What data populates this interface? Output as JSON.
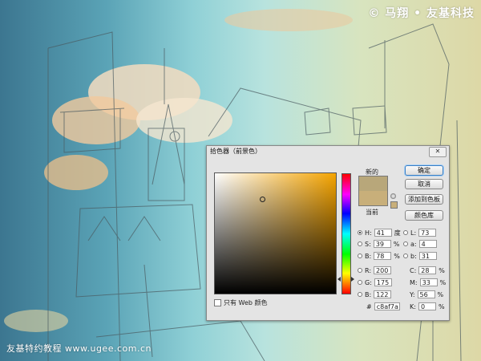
{
  "watermark_top": "© 马翔 • 友基科技",
  "watermark_bottom": "友基特约教程  www.ugee.com.cn",
  "dialog": {
    "title": "拾色器（前景色）",
    "close_label": "✕",
    "new_label": "新的",
    "current_label": "当前",
    "new_color": "#b8a77a",
    "current_color": "#c8af7a",
    "buttons": {
      "ok": "确定",
      "cancel": "取消",
      "add_swatch": "添加到色板",
      "color_libraries": "颜色库"
    },
    "web_only_label": "只有 Web 颜色",
    "hsb": {
      "h_label": "H:",
      "h_value": "41",
      "h_unit": "度",
      "s_label": "S:",
      "s_value": "39",
      "s_unit": "%",
      "b_label": "B:",
      "b_value": "78",
      "b_unit": "%"
    },
    "rgb": {
      "r_label": "R:",
      "r_value": "200",
      "g_label": "G:",
      "g_value": "175",
      "b_label": "B:",
      "b_value": "122"
    },
    "lab": {
      "l_label": "L:",
      "l_value": "73",
      "a_label": "a:",
      "a_value": "4",
      "b_label": "b:",
      "b_value": "31"
    },
    "cmyk": {
      "c_label": "C:",
      "c_value": "28",
      "c_unit": "%",
      "m_label": "M:",
      "m_value": "33",
      "m_unit": "%",
      "y_label": "Y:",
      "y_value": "56",
      "y_unit": "%",
      "k_label": "K:",
      "k_value": "0",
      "k_unit": "%"
    },
    "hex_label": "#",
    "hex_value": "c8af7a"
  }
}
